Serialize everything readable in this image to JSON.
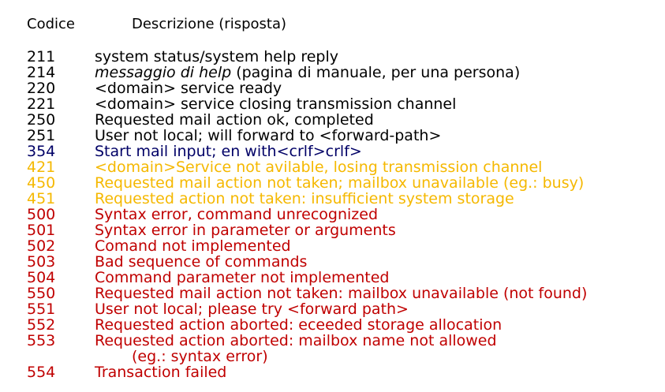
{
  "header": {
    "code_label": "Codice",
    "desc_label": "Descrizione (risposta)"
  },
  "colors": {
    "black": "#000000",
    "navy": "#000066",
    "amber": "#f5b800",
    "red": "#c00000"
  },
  "rows": [
    {
      "code": "211",
      "color": "#000000",
      "desc": "system status/system help reply"
    },
    {
      "code": "214",
      "color": "#000000",
      "desc_italic": "messaggio di help",
      "desc": " (pagina di manuale, per una persona)"
    },
    {
      "code": "220",
      "color": "#000000",
      "desc": "<domain> service ready"
    },
    {
      "code": "221",
      "color": "#000000",
      "desc": "<domain> service closing transmission channel"
    },
    {
      "code": "250",
      "color": "#000000",
      "desc": "Requested mail action ok, completed"
    },
    {
      "code": "251",
      "color": "#000000",
      "desc": "User not local; will forward to <forward-path>"
    },
    {
      "code": "354",
      "color": "#000066",
      "desc": "Start mail input; en with<crlf>crlf>"
    },
    {
      "code": "421",
      "color": "#f5b800",
      "desc": "<domain>Service not avilable, losing transmission channel"
    },
    {
      "code": "450",
      "color": "#f5b800",
      "desc": "Requested mail action not taken; mailbox unavailable (eg.: busy)"
    },
    {
      "code": "451",
      "color": "#f5b800",
      "desc": "Requested action not taken: insufficient system storage"
    },
    {
      "code": "500",
      "color": "#c00000",
      "desc": "Syntax error, command unrecognized"
    },
    {
      "code": "501",
      "color": "#c00000",
      "desc": "Syntax error in parameter or arguments"
    },
    {
      "code": "502",
      "color": "#c00000",
      "desc": "Comand not implemented"
    },
    {
      "code": "503",
      "color": "#c00000",
      "desc": "Bad sequence of commands"
    },
    {
      "code": "504",
      "color": "#c00000",
      "desc": "Command parameter not implemented"
    },
    {
      "code": "550",
      "color": "#c00000",
      "desc": "Requested mail action not taken: mailbox unavailable (not found)"
    },
    {
      "code": "551",
      "color": "#c00000",
      "desc": "User not local; please try <forward path>"
    },
    {
      "code": "552",
      "color": "#c00000",
      "desc": "Requested action aborted: eceeded storage allocation"
    },
    {
      "code": "553",
      "color": "#c00000",
      "desc": "Requested action aborted: mailbox name not allowed",
      "continuation": "(eg.: syntax error)"
    },
    {
      "code": "554",
      "color": "#c00000",
      "desc": "Transaction failed"
    }
  ]
}
